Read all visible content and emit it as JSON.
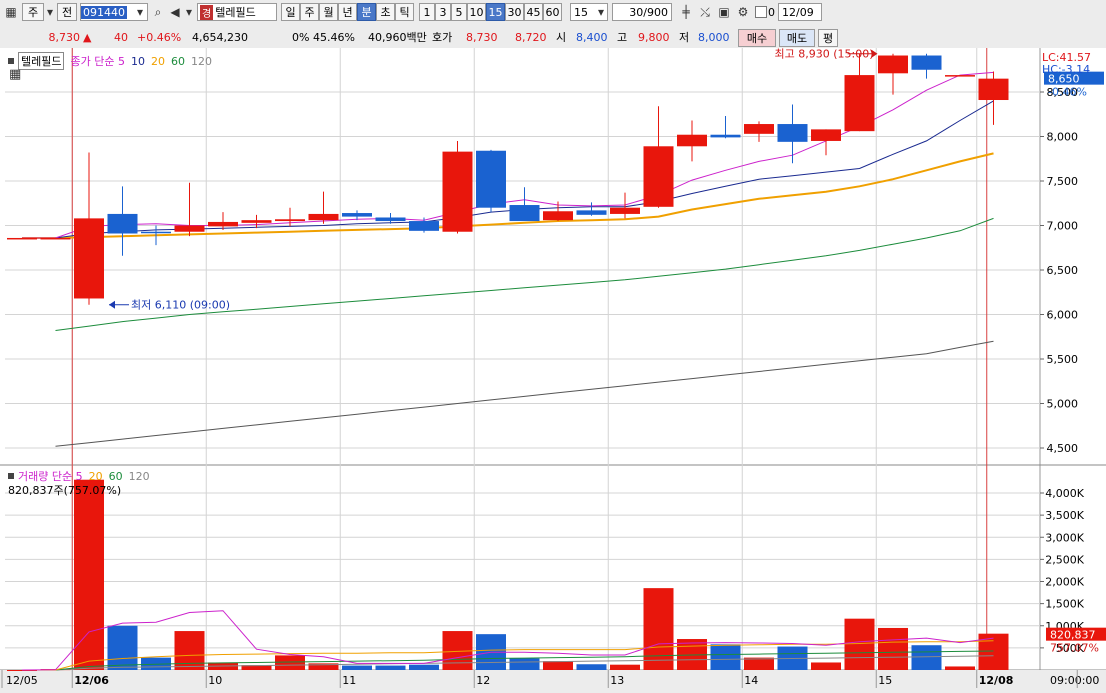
{
  "toolbar": {
    "type_label": "주",
    "prev_label": "전",
    "code": "091440",
    "name": "텔레필드",
    "periods": [
      "일",
      "주",
      "월",
      "년",
      "분",
      "초",
      "틱"
    ],
    "minutes": [
      "1",
      "3",
      "5",
      "10",
      "15",
      "30",
      "45",
      "60"
    ],
    "active_minute": "15",
    "interval_select": "15",
    "count": "30/900",
    "check_label": "0",
    "date": "12/09"
  },
  "quote": {
    "price": "8,730",
    "change": "40",
    "change_pct": "+0.46%",
    "volume": "4,654,230",
    "ratio": "0% 45.46%",
    "amount": "40,960백만",
    "ask_label": "호가",
    "ask1": "8,730",
    "ask2": "8,720",
    "open_label": "시",
    "open": "8,400",
    "high_label": "고",
    "high": "9,800",
    "low_label": "저",
    "low": "8,000",
    "buy_label": "매수",
    "sell_label": "매도",
    "eval_label": "평"
  },
  "price_legend": {
    "name": "텔레필드",
    "ma_label": "종가 단순 5",
    "ma10": "10",
    "ma20": "20",
    "ma60": "60",
    "ma120": "120"
  },
  "volume_legend": {
    "label": "거래량 단순 5",
    "ma20": "20",
    "ma60": "60",
    "ma120": "120",
    "current": "820,837주(757.07%)"
  },
  "right_info": {
    "lc": "LC:41.57",
    "hc": "HC:-3.14",
    "last_price": "8,650",
    "last_pct": "-0.46%",
    "vol_last": "820,837",
    "vol_pct": "757.07%"
  },
  "annotations": {
    "high": "최고 8,930 (15:00)",
    "low": "최저 6,110 (09:00)"
  },
  "colors": {
    "up": "#e8160c",
    "down": "#1a62d0",
    "ma5": "#cc22cc",
    "ma10": "#1a2a90",
    "ma20": "#f0a000",
    "ma60": "#1c8c3c",
    "ma120": "#555555",
    "session_line": "#d84040"
  },
  "chart_data": {
    "type": "candlestick",
    "price_axis": {
      "ticks": [
        4500,
        5000,
        5500,
        6000,
        6500,
        7000,
        7500,
        8000,
        8500
      ],
      "tick_labels": [
        "4,500",
        "5,000",
        "5,500",
        "6,000",
        "6,500",
        "7,000",
        "7,500",
        "8,000",
        "8,500"
      ],
      "range": [
        4350,
        9050
      ]
    },
    "volume_axis": {
      "ticks": [
        500,
        1000,
        1500,
        2000,
        2500,
        3000,
        3500,
        4000
      ],
      "tick_labels": [
        "500K",
        "1,000K",
        "1,500K",
        "2,000K",
        "2,500K",
        "3,000K",
        "3,500K",
        "4,000K"
      ],
      "range": [
        0,
        4300
      ]
    },
    "x_labels": [
      {
        "index": 0,
        "label": "12/05"
      },
      {
        "index": 2,
        "label": "12/06"
      },
      {
        "index": 6,
        "label": "10"
      },
      {
        "index": 10,
        "label": "11"
      },
      {
        "index": 14,
        "label": "12"
      },
      {
        "index": 18,
        "label": "13"
      },
      {
        "index": 22,
        "label": "14"
      },
      {
        "index": 26,
        "label": "15"
      },
      {
        "index": 29,
        "label": "12/08"
      },
      {
        "index": 32,
        "label": "09:00:00"
      }
    ],
    "session_breaks": [
      2,
      29
    ],
    "candles": [
      {
        "o": 6860,
        "h": 6860,
        "l": 6860,
        "c": 6860,
        "v": 0
      },
      {
        "o": 6860,
        "h": 6860,
        "l": 6860,
        "c": 6860,
        "v": 20
      },
      {
        "o": 6180,
        "h": 7820,
        "l": 6110,
        "c": 7080,
        "v": 4300
      },
      {
        "o": 7130,
        "h": 7440,
        "l": 6660,
        "c": 6910,
        "v": 1000
      },
      {
        "o": 6930,
        "h": 7000,
        "l": 6780,
        "c": 6920,
        "v": 280
      },
      {
        "o": 6930,
        "h": 7480,
        "l": 6880,
        "c": 7000,
        "v": 880
      },
      {
        "o": 6990,
        "h": 7150,
        "l": 6950,
        "c": 7040,
        "v": 170
      },
      {
        "o": 7030,
        "h": 7120,
        "l": 6970,
        "c": 7060,
        "v": 110
      },
      {
        "o": 7050,
        "h": 7200,
        "l": 6990,
        "c": 7070,
        "v": 330
      },
      {
        "o": 7060,
        "h": 7380,
        "l": 7020,
        "c": 7130,
        "v": 150
      },
      {
        "o": 7140,
        "h": 7170,
        "l": 7060,
        "c": 7100,
        "v": 100
      },
      {
        "o": 7090,
        "h": 7140,
        "l": 7020,
        "c": 7050,
        "v": 100
      },
      {
        "o": 7050,
        "h": 7090,
        "l": 6920,
        "c": 6940,
        "v": 120
      },
      {
        "o": 6930,
        "h": 7950,
        "l": 6910,
        "c": 7830,
        "v": 880
      },
      {
        "o": 7840,
        "h": 7850,
        "l": 7150,
        "c": 7200,
        "v": 810
      },
      {
        "o": 7230,
        "h": 7430,
        "l": 7050,
        "c": 7050,
        "v": 260
      },
      {
        "o": 7060,
        "h": 7270,
        "l": 7050,
        "c": 7160,
        "v": 200
      },
      {
        "o": 7170,
        "h": 7260,
        "l": 7110,
        "c": 7120,
        "v": 130
      },
      {
        "o": 7130,
        "h": 7370,
        "l": 7080,
        "c": 7200,
        "v": 120
      },
      {
        "o": 7210,
        "h": 8340,
        "l": 7200,
        "c": 7890,
        "v": 1850
      },
      {
        "o": 7890,
        "h": 8180,
        "l": 7720,
        "c": 8020,
        "v": 700
      },
      {
        "o": 8020,
        "h": 8230,
        "l": 7980,
        "c": 7990,
        "v": 580
      },
      {
        "o": 8030,
        "h": 8170,
        "l": 7940,
        "c": 8140,
        "v": 280
      },
      {
        "o": 8140,
        "h": 8360,
        "l": 7700,
        "c": 7940,
        "v": 530
      },
      {
        "o": 7950,
        "h": 8080,
        "l": 7790,
        "c": 8080,
        "v": 170
      },
      {
        "o": 8060,
        "h": 8930,
        "l": 8060,
        "c": 8690,
        "v": 1160
      },
      {
        "o": 8710,
        "h": 8930,
        "l": 8470,
        "c": 8910,
        "v": 950
      },
      {
        "o": 8910,
        "h": 8930,
        "l": 8650,
        "c": 8750,
        "v": 560
      },
      {
        "o": 8690,
        "h": 8690,
        "l": 8690,
        "c": 8690,
        "v": 80
      },
      {
        "o": 8410,
        "h": 8730,
        "l": 8130,
        "c": 8650,
        "v": 821
      }
    ],
    "ma5": [
      6860,
      6860,
      6990,
      7010,
      7020,
      7000,
      7000,
      7010,
      7030,
      7050,
      7070,
      7080,
      7060,
      7150,
      7240,
      7290,
      7230,
      7220,
      7230,
      7340,
      7510,
      7620,
      7720,
      7790,
      7950,
      8110,
      8300,
      8520,
      8690,
      8720
    ],
    "ma10": [
      6860,
      6860,
      6910,
      6930,
      6950,
      6960,
      6970,
      6980,
      6990,
      7000,
      7020,
      7030,
      7040,
      7090,
      7150,
      7180,
      7200,
      7210,
      7210,
      7270,
      7360,
      7440,
      7520,
      7560,
      7600,
      7640,
      7800,
      7950,
      8180,
      8400
    ],
    "ma20": [
      6860,
      6860,
      6870,
      6880,
      6890,
      6900,
      6910,
      6920,
      6930,
      6940,
      6950,
      6960,
      6970,
      6990,
      7010,
      7030,
      7050,
      7060,
      7070,
      7100,
      7180,
      7240,
      7300,
      7340,
      7380,
      7440,
      7520,
      7620,
      7720,
      7810
    ],
    "ma60": [
      null,
      5820,
      5870,
      5920,
      5960,
      6000,
      6030,
      6060,
      6090,
      6120,
      6150,
      6180,
      6210,
      6240,
      6270,
      6300,
      6330,
      6360,
      6390,
      6430,
      6470,
      6510,
      6560,
      6610,
      6660,
      6720,
      6790,
      6860,
      6940,
      7080
    ],
    "ma120": [
      null,
      4520,
      4560,
      4600,
      4640,
      4680,
      4720,
      4760,
      4800,
      4840,
      4880,
      4920,
      4960,
      5000,
      5040,
      5080,
      5120,
      5160,
      5200,
      5240,
      5280,
      5320,
      5360,
      5400,
      5440,
      5480,
      5520,
      5560,
      5630,
      5700
    ],
    "vol_ma5": [
      0,
      4,
      860,
      1060,
      1080,
      1300,
      1340,
      470,
      350,
      300,
      150,
      150,
      150,
      280,
      400,
      400,
      380,
      340,
      340,
      590,
      610,
      620,
      610,
      600,
      560,
      640,
      680,
      720,
      620,
      720
    ],
    "vol_ma20": [
      0,
      1,
      200,
      260,
      300,
      330,
      350,
      360,
      370,
      380,
      380,
      390,
      390,
      420,
      450,
      460,
      460,
      460,
      460,
      520,
      540,
      560,
      570,
      580,
      580,
      600,
      630,
      640,
      640,
      660
    ],
    "vol_ma60": [
      0,
      1,
      80,
      110,
      130,
      150,
      160,
      170,
      180,
      190,
      200,
      210,
      220,
      240,
      260,
      270,
      280,
      290,
      300,
      320,
      340,
      350,
      360,
      370,
      380,
      390,
      400,
      410,
      420,
      430
    ],
    "vol_ma120": [
      0,
      0,
      40,
      60,
      70,
      80,
      90,
      100,
      110,
      120,
      130,
      140,
      150,
      160,
      170,
      180,
      190,
      200,
      210,
      220,
      230,
      240,
      250,
      260,
      270,
      280,
      290,
      300,
      310,
      320
    ]
  }
}
